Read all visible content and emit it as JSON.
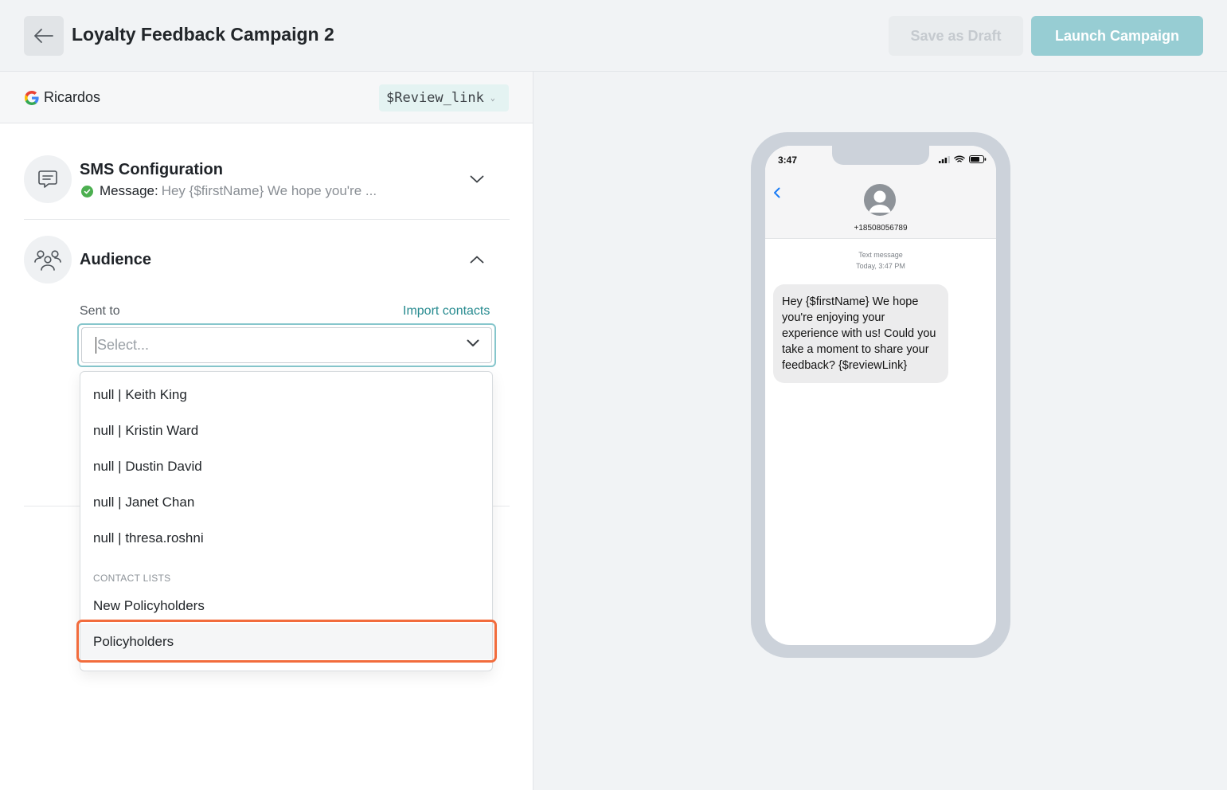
{
  "header": {
    "title": "Loyalty Feedback Campaign 2",
    "save_draft_label": "Save as Draft",
    "launch_label": "Launch Campaign"
  },
  "source": {
    "name": "Ricardos",
    "variable_label": "$Review_link"
  },
  "sms_section": {
    "title": "SMS Configuration",
    "message_label": "Message:",
    "message_preview": "Hey {$firstName} We hope you're ..."
  },
  "audience_section": {
    "title": "Audience",
    "sent_to_label": "Sent to",
    "import_label": "Import contacts",
    "select_placeholder": "Select...",
    "options": [
      "null | Keith King",
      "null | Kristin Ward",
      "null | Dustin David",
      "null | Janet Chan",
      "null | thresa.roshni"
    ],
    "group_label": "CONTACT LISTS",
    "lists": [
      "New Policyholders",
      "Policyholders"
    ]
  },
  "phone": {
    "time": "3:47",
    "battery": "67",
    "number": "+18508056789",
    "meta_line1": "Text message",
    "meta_line2": "Today, 3:47 PM",
    "message": "Hey {$firstName} We hope you're enjoying your experience with us! Could you take a moment to share your feedback? {$reviewLink}"
  },
  "colors": {
    "accent": "#97cdd3",
    "link": "#268a8f",
    "highlight": "#f26c3d",
    "success": "#4caf50"
  }
}
